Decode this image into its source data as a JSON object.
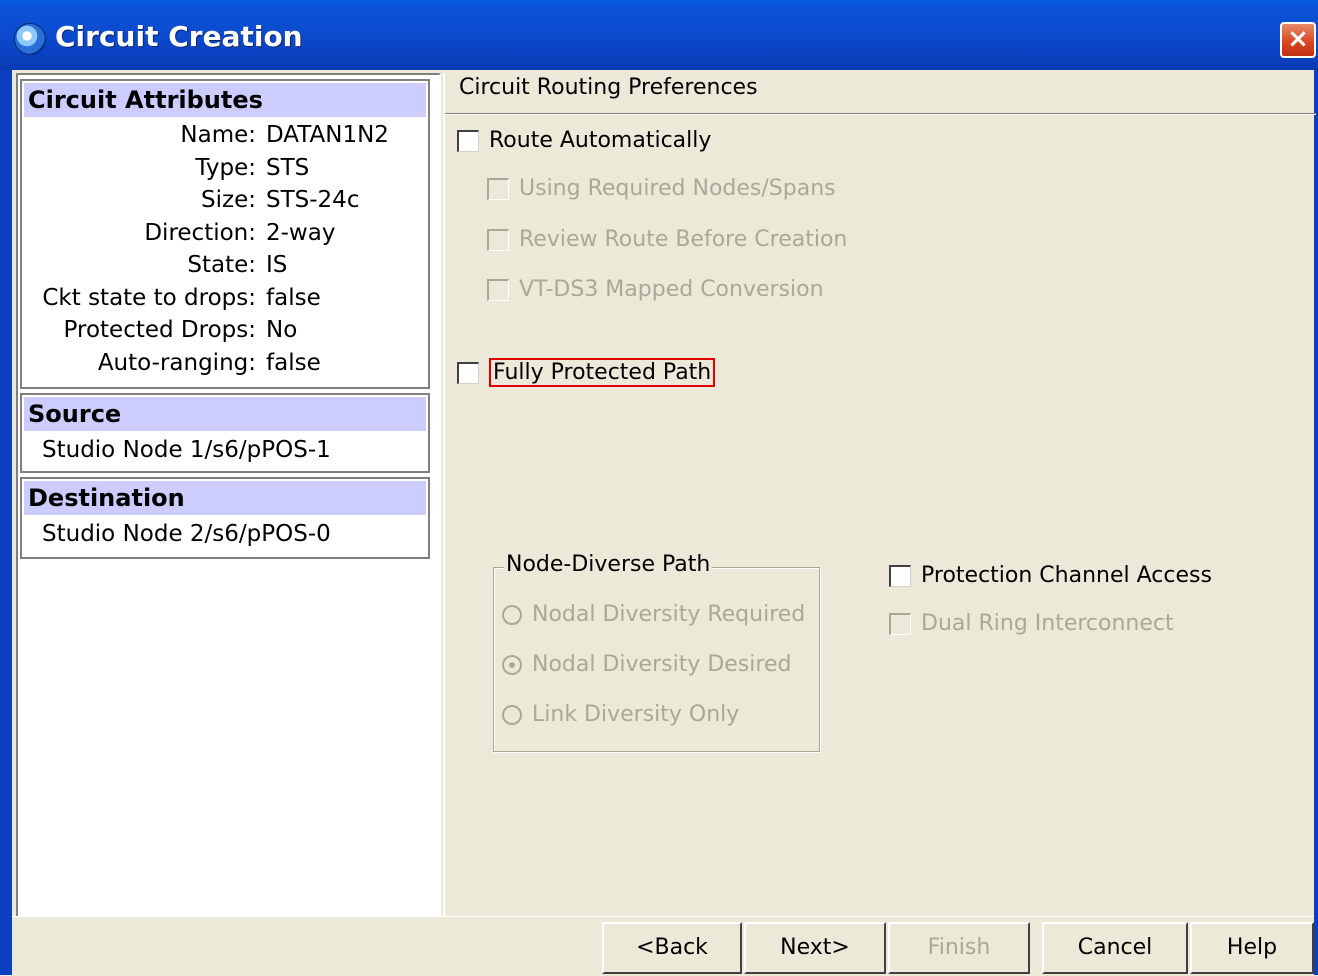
{
  "window": {
    "title": "Circuit Creation",
    "close_label": "×"
  },
  "left": {
    "attributes": {
      "header": "Circuit Attributes",
      "rows": [
        {
          "key": "Name:",
          "value": "DATAN1N2"
        },
        {
          "key": "Type:",
          "value": "STS"
        },
        {
          "key": "Size:",
          "value": "STS-24c"
        },
        {
          "key": "Direction:",
          "value": "2-way"
        },
        {
          "key": "State:",
          "value": "IS"
        },
        {
          "key": "Ckt state to drops:",
          "value": "false"
        },
        {
          "key": "Protected Drops:",
          "value": "No"
        },
        {
          "key": "Auto-ranging:",
          "value": "false"
        }
      ]
    },
    "source": {
      "header": "Source",
      "value": "Studio Node 1/s6/pPOS-1"
    },
    "destination": {
      "header": "Destination",
      "value": "Studio Node 2/s6/pPOS-0"
    }
  },
  "right": {
    "section_title": "Circuit Routing Preferences",
    "route_automatically": "Route Automatically",
    "using_required": "Using Required Nodes/Spans",
    "review_route": "Review Route Before Creation",
    "vt_ds3": "VT-DS3 Mapped Conversion",
    "fully_protected": "Fully Protected Path",
    "node_diverse": {
      "legend": "Node-Diverse Path",
      "required": "Nodal Diversity Required",
      "desired": "Nodal Diversity Desired",
      "link_only": "Link Diversity Only",
      "selected": "Nodal Diversity Desired"
    },
    "protection_channel": "Protection Channel Access",
    "dual_ring": "Dual Ring Interconnect"
  },
  "buttons": {
    "back": "<Back",
    "next": "Next>",
    "finish": "Finish",
    "cancel": "Cancel",
    "help": "Help"
  }
}
